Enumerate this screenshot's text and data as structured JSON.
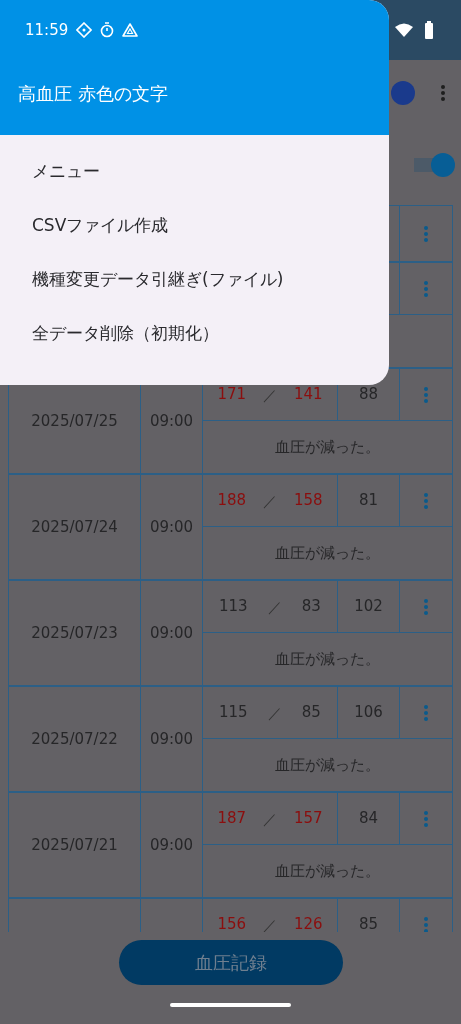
{
  "status_bar": {
    "time": "11:59"
  },
  "drawer": {
    "title": "高血圧 赤色の文字",
    "items": [
      {
        "label": "メニュー"
      },
      {
        "label": "CSVファイル作成"
      },
      {
        "label": "機種変更データ引継ぎ(ファイル)"
      },
      {
        "label": "全データ削除（初期化）"
      }
    ]
  },
  "toggle": {
    "on": true
  },
  "table": {
    "rows": [
      {
        "date": "2025/07/25",
        "time": "09:00",
        "systolic": "171",
        "separator": "／",
        "diastolic": "141",
        "pulse": "88",
        "note": "血圧が減った。",
        "high": true
      },
      {
        "date": "2025/07/24",
        "time": "09:00",
        "systolic": "188",
        "separator": "／",
        "diastolic": "158",
        "pulse": "81",
        "note": "血圧が減った。",
        "high": true
      },
      {
        "date": "2025/07/23",
        "time": "09:00",
        "systolic": "113",
        "separator": "／",
        "diastolic": "83",
        "pulse": "102",
        "note": "血圧が減った。",
        "high": false
      },
      {
        "date": "2025/07/22",
        "time": "09:00",
        "systolic": "115",
        "separator": "／",
        "diastolic": "85",
        "pulse": "106",
        "note": "血圧が減った。",
        "high": false
      },
      {
        "date": "2025/07/21",
        "time": "09:00",
        "systolic": "187",
        "separator": "／",
        "diastolic": "157",
        "pulse": "84",
        "note": "血圧が減った。",
        "high": true
      },
      {
        "systolic": "156",
        "separator": "／",
        "diastolic": "126",
        "pulse": "85",
        "high": true
      }
    ]
  },
  "record_button": {
    "label": "血圧記録"
  }
}
